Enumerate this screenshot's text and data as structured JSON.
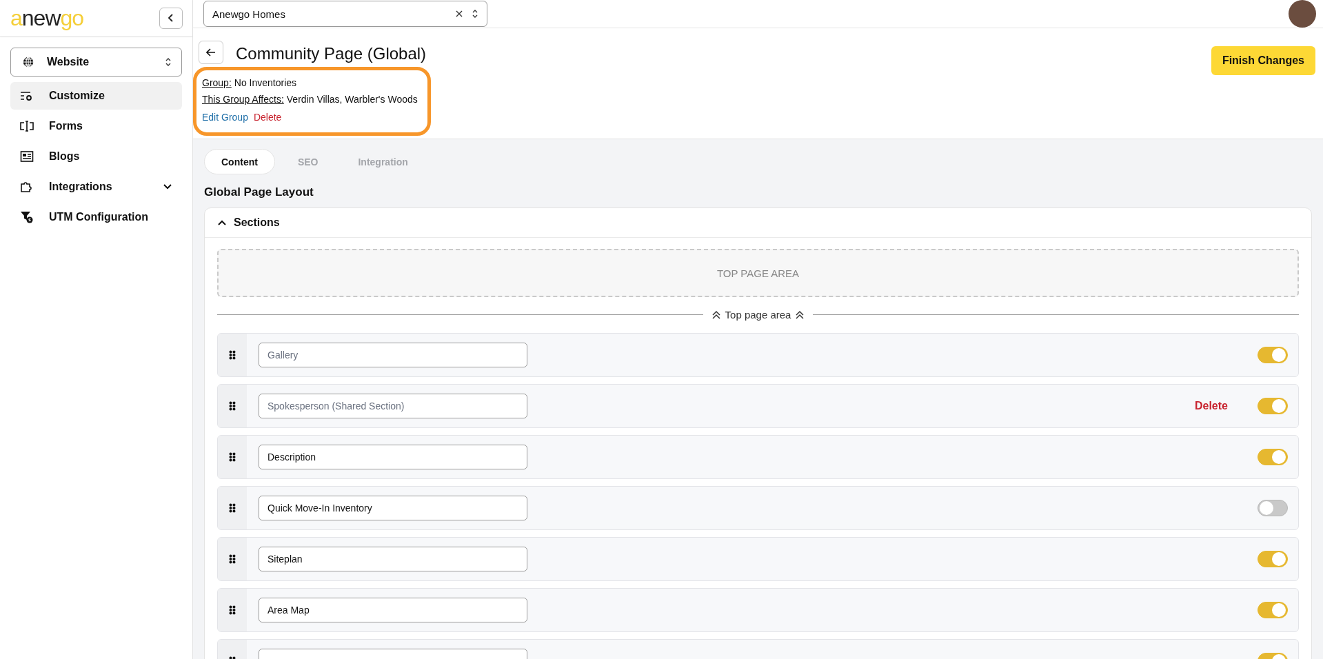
{
  "logo": [
    {
      "text": "a",
      "accent": true
    },
    {
      "text": "new",
      "accent": false
    },
    {
      "text": "go",
      "accent": true
    }
  ],
  "topbar": {
    "company": "Anewgo Homes"
  },
  "sidebar": {
    "selector": "Website",
    "items": [
      {
        "label": "Customize",
        "kind": "customize",
        "selected": true,
        "expandable": false
      },
      {
        "label": "Forms",
        "kind": "forms",
        "selected": false,
        "expandable": false
      },
      {
        "label": "Blogs",
        "kind": "blogs",
        "selected": false,
        "expandable": false
      },
      {
        "label": "Integrations",
        "kind": "integrations",
        "selected": false,
        "expandable": true
      },
      {
        "label": "UTM Configuration",
        "kind": "utm",
        "selected": false,
        "expandable": false
      }
    ]
  },
  "header": {
    "title": "Community Page (Global)",
    "finish_button": "Finish Changes",
    "highlighted": true,
    "group_label": "Group:",
    "group_value": "No Inventories",
    "affects_label": "This Group Affects:",
    "affects_value": "Verdin Villas, Warbler's Woods",
    "edit_link": "Edit Group",
    "delete_link": "Delete"
  },
  "tabs": [
    {
      "label": "Content",
      "selected": true
    },
    {
      "label": "SEO",
      "selected": false
    },
    {
      "label": "Integration",
      "selected": false
    }
  ],
  "layout_title": "Global Page Layout",
  "sections": {
    "title": "Sections",
    "expanded": true,
    "drop_zone": "TOP PAGE AREA",
    "divider": "Top page area",
    "rows": [
      {
        "placeholder": "Gallery",
        "on": true
      },
      {
        "placeholder": "Spokesperson (Shared Section)",
        "delete": "Delete",
        "on": true
      },
      {
        "value": "Description",
        "on": true
      },
      {
        "value": "Quick Move-In Inventory",
        "on": false
      },
      {
        "value": "Siteplan",
        "on": true
      },
      {
        "value": "Area Map",
        "on": true
      },
      {
        "on": true
      }
    ]
  }
}
